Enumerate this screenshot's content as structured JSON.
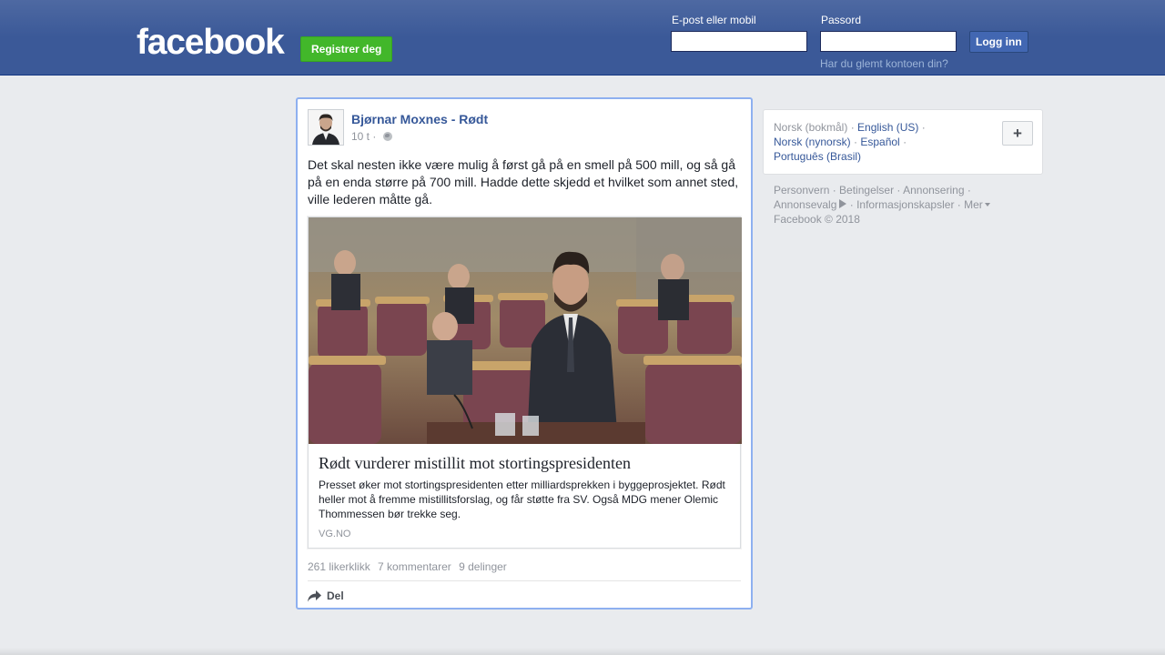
{
  "header": {
    "logo": "facebook",
    "register_label": "Registrer deg",
    "email_label": "E-post eller mobil",
    "email_value": "",
    "password_label": "Passord",
    "password_value": "",
    "login_label": "Logg inn",
    "forgot_label": "Har du glemt kontoen din?"
  },
  "post": {
    "author": "Bjørnar Moxnes - Rødt",
    "time": "10 t",
    "separator": "·",
    "text": "Det skal nesten ikke være mulig å først gå på en smell på 500 mill, og så gå på en enda større på 700 mill. Hadde dette skjedd et hvilket som annet sted, ville lederen måtte gå.",
    "link": {
      "title": "Rødt vurderer mistillit mot stortingspresidenten",
      "description": "Presset øker mot stortingspresidenten etter milliardsprekken i byggeprosjektet. Rødt heller mot å fremme mistillitsforslag, og får støtte fra SV. Også MDG mener Olemic Thommessen bør trekke seg.",
      "domain": "VG.NO"
    },
    "stats": {
      "likes": "261 likerklikk",
      "comments": "7 kommentarer",
      "shares": "9 delinger"
    },
    "share_label": "Del"
  },
  "sidebar": {
    "languages": {
      "current": "Norsk (bokmål)",
      "options": [
        "English (US)",
        "Norsk (nynorsk)",
        "Español",
        "Português (Brasil)"
      ]
    },
    "add_language": "+",
    "footer": {
      "links": [
        "Personvern",
        "Betingelser",
        "Annonsering",
        "Annonsevalg",
        "Informasjonskapsler",
        "Mer"
      ],
      "copyright": "Facebook © 2018"
    }
  },
  "colors": {
    "brand": "#3b5998",
    "link": "#365899",
    "register_green": "#42b72a",
    "page_bg": "#e9ebee"
  }
}
